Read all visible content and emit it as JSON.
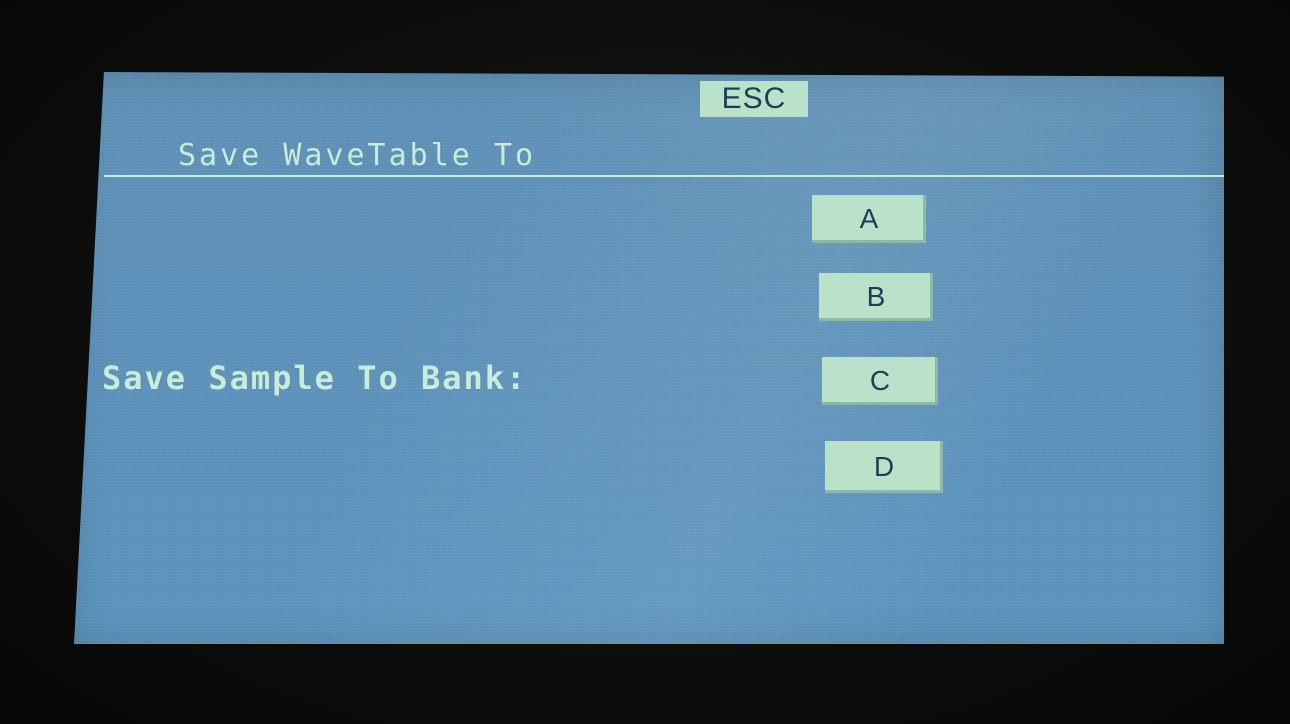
{
  "header": {
    "esc_label": "ESC",
    "title": "Save WaveTable To"
  },
  "main": {
    "bank_prompt": "Save Sample To Bank:",
    "banks": [
      {
        "label": "A"
      },
      {
        "label": "B"
      },
      {
        "label": "C"
      },
      {
        "label": "D"
      }
    ]
  },
  "colors": {
    "screen_background": "#5b90b8",
    "button_fill": "#b9e2c9",
    "text": "#c8ecd7",
    "button_text": "#1e3d56"
  }
}
